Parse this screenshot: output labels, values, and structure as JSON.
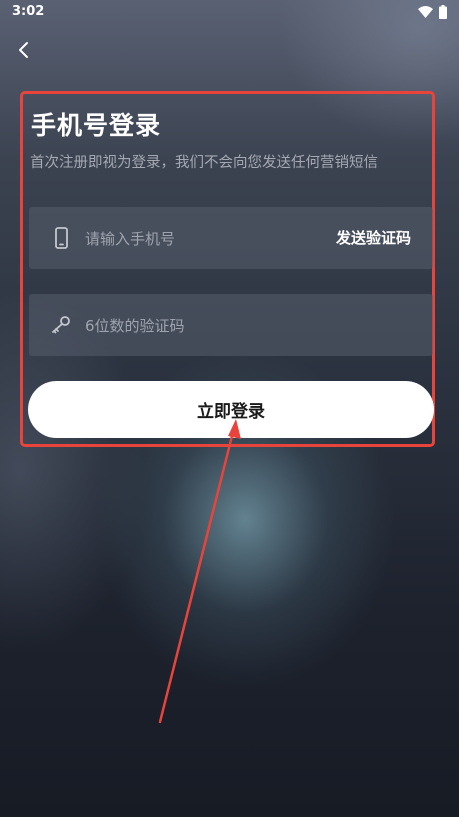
{
  "status_bar": {
    "time": "3:02",
    "wifi_icon": "wifi-icon",
    "battery_icon": "battery-icon"
  },
  "nav": {
    "back_icon": "chevron-left-icon"
  },
  "login": {
    "title": "手机号登录",
    "subtitle": "首次注册即视为登录，我们不会向您发送任何营销短信",
    "phone": {
      "icon": "phone-icon",
      "value": "",
      "placeholder": "请输入手机号",
      "send_code_label": "发送验证码"
    },
    "code": {
      "icon": "key-icon",
      "value": "",
      "placeholder": "6位数的验证码"
    },
    "submit_label": "立即登录"
  },
  "colors": {
    "highlight_border": "#e8443b",
    "arrow": "#e8443b",
    "button_bg": "#ffffff",
    "button_text": "#1a1a1a"
  }
}
